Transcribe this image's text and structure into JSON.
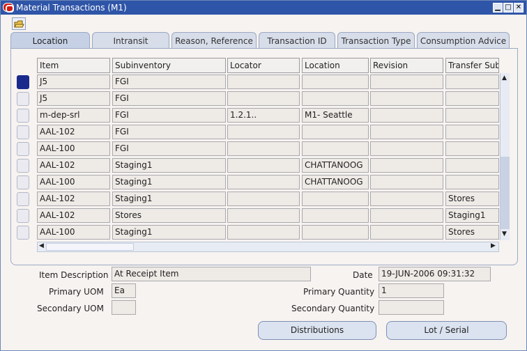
{
  "window": {
    "title": "Material Transactions (M1)"
  },
  "tabs": [
    "Location",
    "Intransit",
    "Reason, Reference",
    "Transaction ID",
    "Transaction Type",
    "Consumption Advice"
  ],
  "columns": [
    "Item",
    "Subinventory",
    "Locator",
    "Location",
    "Revision",
    "Transfer Sub"
  ],
  "rows": [
    [
      "J5",
      "FGI",
      "",
      "",
      "",
      ""
    ],
    [
      "J5",
      "FGI",
      "",
      "",
      "",
      ""
    ],
    [
      "m-dep-srl",
      "FGI",
      "1.2.1..",
      "M1- Seattle",
      "",
      ""
    ],
    [
      "AAL-102",
      "FGI",
      "",
      "",
      "",
      ""
    ],
    [
      "AAL-100",
      "FGI",
      "",
      "",
      "",
      ""
    ],
    [
      "AAL-102",
      "Staging1",
      "",
      "CHATTANOOG",
      "",
      ""
    ],
    [
      "AAL-100",
      "Staging1",
      "",
      "CHATTANOOG",
      "",
      ""
    ],
    [
      "AAL-102",
      "Staging1",
      "",
      "",
      "",
      "Stores"
    ],
    [
      "AAL-102",
      "Stores",
      "",
      "",
      "",
      "Staging1"
    ],
    [
      "AAL-100",
      "Staging1",
      "",
      "",
      "",
      "Stores"
    ]
  ],
  "details": {
    "item_description_label": "Item Description",
    "item_description": "At Receipt Item",
    "date_label": "Date",
    "date": "19-JUN-2006 09:31:32",
    "primary_uom_label": "Primary UOM",
    "primary_uom": "Ea",
    "primary_quantity_label": "Primary Quantity",
    "primary_quantity": "1",
    "secondary_uom_label": "Secondary UOM",
    "secondary_uom": "",
    "secondary_quantity_label": "Secondary Quantity",
    "secondary_quantity": ""
  },
  "buttons": {
    "distributions": "Distributions",
    "lot_serial": "Lot / Serial"
  }
}
